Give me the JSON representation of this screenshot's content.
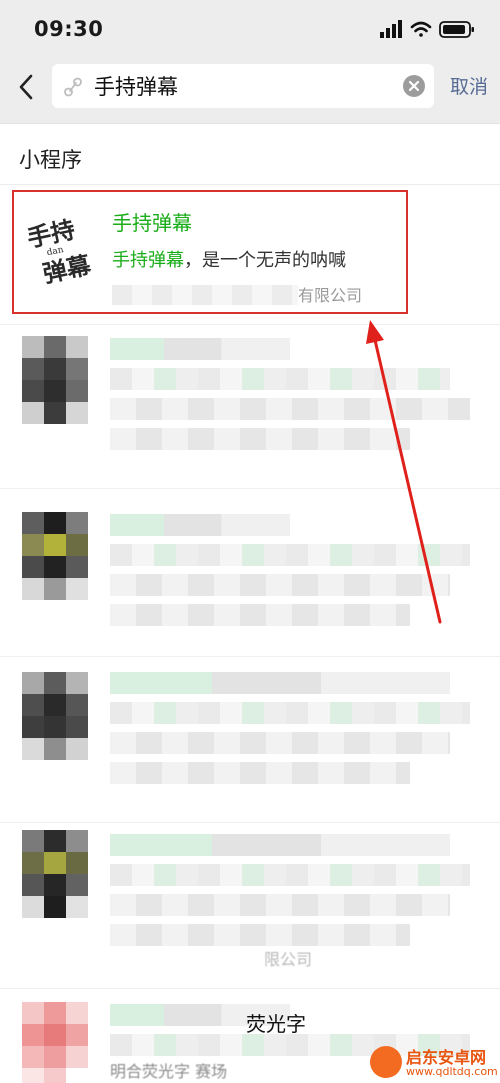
{
  "status_bar": {
    "time": "09:30",
    "icons": [
      "signal-icon",
      "wifi-icon",
      "battery-icon"
    ]
  },
  "search": {
    "query": "手持弹幕",
    "cancel_label": "取消",
    "icons": [
      "back-icon",
      "link-icon",
      "clear-icon"
    ]
  },
  "section": {
    "title": "小程序"
  },
  "highlighted_result": {
    "logo_text": [
      "手持",
      "dan",
      "弹幕"
    ],
    "name": "手持弹幕",
    "desc_highlight": "手持弹幕",
    "desc_rest": "，是一个无声的呐喊",
    "company_suffix": "有限公司"
  },
  "blurred_items": [
    {
      "index": 1
    },
    {
      "index": 2
    },
    {
      "index": 3
    },
    {
      "index": 4,
      "partial_company": "限公司"
    },
    {
      "index": 5,
      "partial_title": "荧光字",
      "partial_desc": "明合荧光字   赛场"
    }
  ],
  "watermark": {
    "name": "启东安卓网",
    "url": "www.qdltdq.com"
  },
  "colors": {
    "accent_green": "#1aad19",
    "cancel_blue": "#576b95",
    "highlight_red": "#d9302c"
  }
}
